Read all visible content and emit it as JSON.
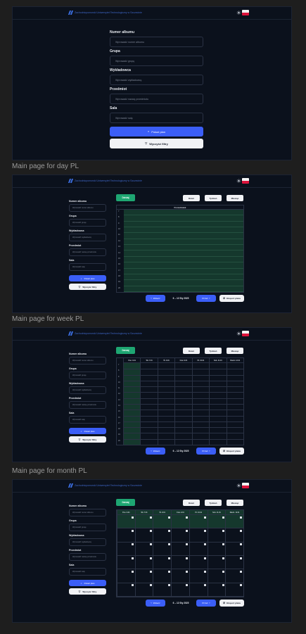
{
  "labels": {
    "day": "Main page for day PL",
    "week": "Main page for week PL",
    "month": "Main page for month PL"
  },
  "header": {
    "logo_text": "Zachodniopomorski Uniwersytet Technologiczny w Szczecinie",
    "theme_icon": "sun-icon",
    "language_flag": "flag-pl-icon"
  },
  "form": {
    "album_label": "Numer albumu",
    "album_placeholder": "Wprowadź numer albumu",
    "group_label": "Grupa",
    "group_placeholder": "Wprowadź grupę",
    "lecturer_label": "Wykładowca",
    "lecturer_placeholder": "Wprowadź wykładowcę",
    "subject_label": "Przedmiot",
    "subject_placeholder": "Wprowadź nazwę przedmiotu",
    "room_label": "Sala",
    "room_placeholder": "Wprowadź salę",
    "search_label": "Pokaż plan",
    "clear_label": "Wyczyść filtry"
  },
  "toolbar": {
    "today_label": "Dzisiaj",
    "day_label": "Dzień",
    "week_label": "Tydzień",
    "month_label": "Miesiąc",
    "prev_label": "Wstecz",
    "next_label": "Przód",
    "range_label": "6 – 12 Sty 2025",
    "export_label": "Eksport planu"
  },
  "day": {
    "column_header": "Poniedziałek",
    "hours": [
      "7",
      "8",
      "9",
      "10",
      "11",
      "12",
      "13",
      "14",
      "15",
      "16",
      "17",
      "18",
      "19",
      "20"
    ]
  },
  "week": {
    "days": [
      "Pon. 6.01",
      "Wt. 7.01",
      "Śr. 8.01",
      "Czw. 9.01",
      "Pt. 10.01",
      "Sob. 11.01",
      "Niedz. 12.01"
    ],
    "hours": [
      "7",
      "8",
      "9",
      "10",
      "11",
      "12",
      "13",
      "14",
      "15",
      "16",
      "17",
      "18",
      "19",
      "20"
    ]
  },
  "month": {
    "days": [
      "Pon. 6.01",
      "Wt. 7.01",
      "Śr. 8.01",
      "Czw. 9.01",
      "Pt. 10.01",
      "Sob. 11.01",
      "Niedz. 12.01"
    ]
  },
  "colors": {
    "background": "#0b111c",
    "accent_blue": "#3b5ef7",
    "today_green": "#1ea672",
    "highlight_column": "#15382d"
  }
}
